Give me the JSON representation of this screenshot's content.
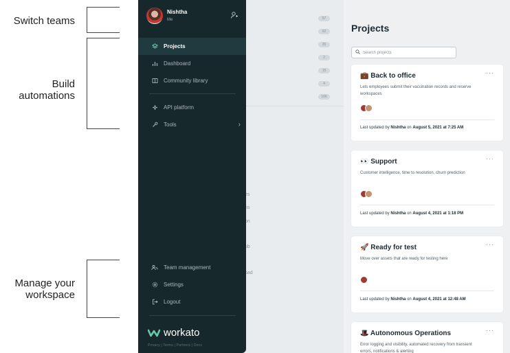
{
  "annotations": {
    "switch_teams": "Switch teams",
    "build_automations_1": "Build",
    "build_automations_2": "automations",
    "manage_workspace_1": "Manage your",
    "manage_workspace_2": "workspace"
  },
  "sidebar": {
    "user_name": "Nishtha",
    "user_sub": "Me",
    "items_top": [
      {
        "label": "Projects",
        "icon": "projects-icon"
      },
      {
        "label": "Dashboard",
        "icon": "dashboard-icon"
      },
      {
        "label": "Community library",
        "icon": "book-icon"
      }
    ],
    "items_mid": [
      {
        "label": "API platform",
        "icon": "api-icon"
      },
      {
        "label": "Tools",
        "icon": "wrench-icon"
      }
    ],
    "items_bottom": [
      {
        "label": "Team management",
        "icon": "team-icon"
      },
      {
        "label": "Settings",
        "icon": "gear-icon"
      },
      {
        "label": "Logout",
        "icon": "logout-icon"
      }
    ],
    "logo_text": "workato",
    "footer": "Privacy  |  Terms  |  Partners  |  Docs"
  },
  "background": {
    "counts": [
      "57",
      "62",
      "35",
      "2",
      "15",
      "4",
      "106"
    ],
    "fragments": [
      "es",
      "ns",
      "on",
      "ub",
      "pad",
      "t"
    ]
  },
  "projects": {
    "title": "Projects",
    "search_placeholder": "Search projects",
    "menu_glyph": "···",
    "updated_prefix": "Last updated by",
    "updated_on": "on",
    "cards": [
      {
        "emoji": "💼",
        "name": "Back to office",
        "description": "Lets employees submit their vaccination records and reserve workspaces",
        "updated_by": "Nishtha",
        "updated_at": "August 5, 2021 at 7:25 AM"
      },
      {
        "emoji": "👀",
        "name": "Support",
        "description": "Customer intelligence, time to resolution, churn prediction",
        "updated_by": "Nishtha",
        "updated_at": "August 4, 2021 at 1:18 PM"
      },
      {
        "emoji": "🚀",
        "name": "Ready for test",
        "description": "Move over assets that are ready for testing here",
        "updated_by": "Nishtha",
        "updated_at": "August 4, 2021 at 12:48 AM"
      },
      {
        "emoji": "🎩",
        "name": "Autonomous Operations",
        "description": "Error logging and visibility, automated recovery from transient errors, notifications & alerting",
        "updated_by": "",
        "updated_at": ""
      }
    ]
  },
  "colors": {
    "sidebar_bg": "#17282d",
    "sidebar_active": "#213a40",
    "brand_green": "#67c7a9"
  }
}
